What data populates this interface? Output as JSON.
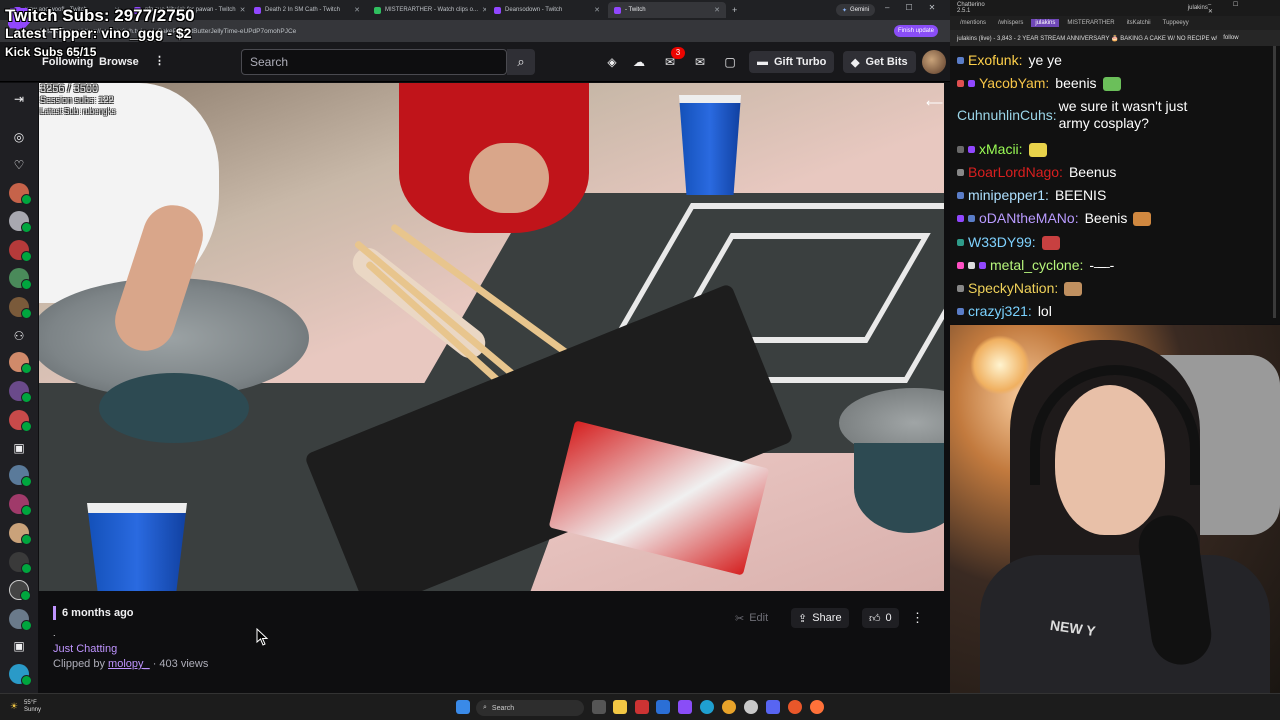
{
  "browser": {
    "tabs": [
      {
        "label": "wow ago woof! - Twitch",
        "active": false
      },
      {
        "label": "pfp sue Nitwick for pawan - Twitch",
        "active": false
      },
      {
        "label": "Death 2 In SM Cath - Twitch",
        "active": false
      },
      {
        "label": "MISTERARTHER - Watch clips o...",
        "active": false
      },
      {
        "label": "Deansodown - Twitch",
        "active": false
      },
      {
        "label": "- Twitch",
        "active": true
      }
    ],
    "gemini_label": "Gemini",
    "url": "Latest Tipper: https://www.twitch.tv/...edyCakePeanutButterJellyTime-eUPdP7omohPJCe",
    "finish_update": "Finish update"
  },
  "overlay": {
    "subs": "Twitch Subs: 2977/2750",
    "tipper": "Latest Tipper: vino_ggg - $2",
    "kick": "Kick Subs 65/15",
    "session_count": "3256 / 3500",
    "session_subs": "Session subs: 122",
    "latest_sub": "Latest Sub: rubengks"
  },
  "nav": {
    "following": "Following",
    "browse": "Browse",
    "search_placeholder": "Search",
    "notification_count": "3",
    "gift_turbo": "Gift Turbo",
    "get_bits": "Get Bits"
  },
  "clip": {
    "time_ago": "6 months ago",
    "title": ".",
    "category": "Just Chatting",
    "clipped_by_prefix": "Clipped by",
    "clipper": "molopy_",
    "views": "· 403 views",
    "edit": "Edit",
    "share": "Share",
    "likes": "0"
  },
  "taskbar": {
    "temp": "55°F",
    "condition": "Sunny",
    "search": "Search"
  },
  "chatterino": {
    "title": "Chatterino 2.5.1",
    "user": "julakins",
    "tabs": [
      "/mentions",
      "/whispers",
      "julakins",
      "MISTERARTHER",
      "itsKatchii",
      "Tuppeeyy"
    ],
    "header": "julakins (live) - 3,843 - 2 YEAR STREAM ANNIVERSARY 🎂 BAKING A CAKE W/ NO RECIPE w/",
    "header_follow": "follow",
    "messages": [
      {
        "user": "Exofunk",
        "text": "ye ye",
        "color": "#ffd14a",
        "badges": [
          "#5a7dc8"
        ],
        "emote": ""
      },
      {
        "user": "YacobYam",
        "text": "beenis",
        "color": "#f7c548",
        "badges": [
          "#e05050",
          "#9147ff"
        ],
        "emote": "#6bbf5a"
      },
      {
        "user": "CuhnuhlinCuhs",
        "text": "we sure it wasn't just army cosplay?",
        "color": "#9bd6e8",
        "badges": [],
        "emote": ""
      },
      {
        "user": "xMacii",
        "text": "",
        "color": "#9afc55",
        "badges": [
          "#6a6a6a",
          "#9147ff"
        ],
        "emote": "#e8d24a"
      },
      {
        "user": "BoarLordNago",
        "text": "Beenus",
        "color": "#d91f1f",
        "badges": [
          "#888888"
        ],
        "emote": ""
      },
      {
        "user": "minipepper1",
        "text": "BEENIS",
        "color": "#aee0ff",
        "badges": [
          "#5a7dc8"
        ],
        "emote": ""
      },
      {
        "user": "oDANtheMANo",
        "text": "Beenis",
        "color": "#b99bff",
        "badges": [
          "#9147ff",
          "#5a7dc8"
        ],
        "emote": "#d08840"
      },
      {
        "user": "W33DY99",
        "text": "",
        "color": "#7fd2ff",
        "badges": [
          "#2f9c8a"
        ],
        "emote": "#c84040"
      },
      {
        "user": "metal_cyclone",
        "text": "- ̶ ̶ ̶ -",
        "color": "#b7f57c",
        "badges": [
          "#ff4fc3",
          "#dddddd",
          "#9147ff"
        ],
        "emote": ""
      },
      {
        "user": "SpeckyNation",
        "text": "",
        "color": "#f0d25a",
        "badges": [
          "#888888"
        ],
        "emote": "#c09060"
      },
      {
        "user": "crazyj321",
        "text": "lol",
        "color": "#7ad2ff",
        "badges": [
          "#5a7dc8"
        ],
        "emote": ""
      }
    ]
  },
  "webcam": {
    "shirt_text": "NEW Y"
  }
}
